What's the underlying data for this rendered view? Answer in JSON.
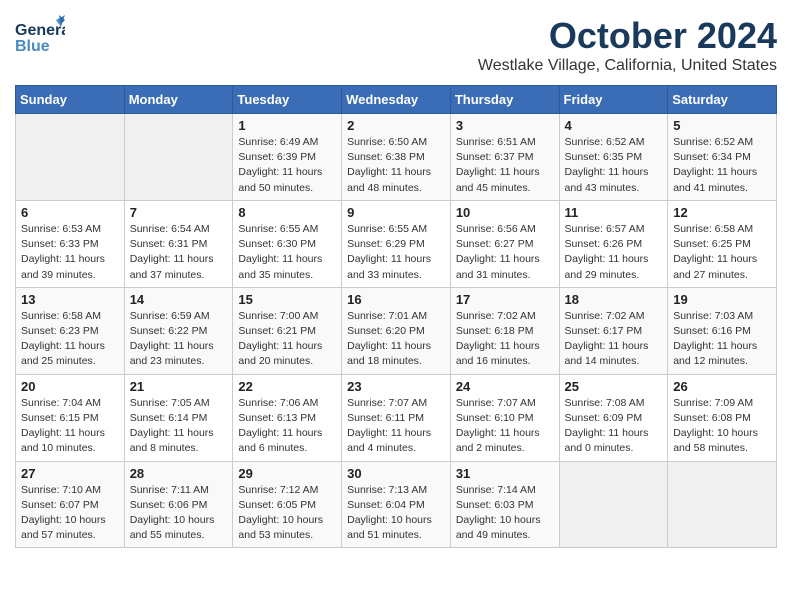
{
  "header": {
    "logo_general": "General",
    "logo_blue": "Blue",
    "title": "October 2024",
    "subtitle": "Westlake Village, California, United States"
  },
  "weekdays": [
    "Sunday",
    "Monday",
    "Tuesday",
    "Wednesday",
    "Thursday",
    "Friday",
    "Saturday"
  ],
  "weeks": [
    [
      {
        "day": "",
        "info": ""
      },
      {
        "day": "",
        "info": ""
      },
      {
        "day": "1",
        "info": "Sunrise: 6:49 AM\nSunset: 6:39 PM\nDaylight: 11 hours and 50 minutes."
      },
      {
        "day": "2",
        "info": "Sunrise: 6:50 AM\nSunset: 6:38 PM\nDaylight: 11 hours and 48 minutes."
      },
      {
        "day": "3",
        "info": "Sunrise: 6:51 AM\nSunset: 6:37 PM\nDaylight: 11 hours and 45 minutes."
      },
      {
        "day": "4",
        "info": "Sunrise: 6:52 AM\nSunset: 6:35 PM\nDaylight: 11 hours and 43 minutes."
      },
      {
        "day": "5",
        "info": "Sunrise: 6:52 AM\nSunset: 6:34 PM\nDaylight: 11 hours and 41 minutes."
      }
    ],
    [
      {
        "day": "6",
        "info": "Sunrise: 6:53 AM\nSunset: 6:33 PM\nDaylight: 11 hours and 39 minutes."
      },
      {
        "day": "7",
        "info": "Sunrise: 6:54 AM\nSunset: 6:31 PM\nDaylight: 11 hours and 37 minutes."
      },
      {
        "day": "8",
        "info": "Sunrise: 6:55 AM\nSunset: 6:30 PM\nDaylight: 11 hours and 35 minutes."
      },
      {
        "day": "9",
        "info": "Sunrise: 6:55 AM\nSunset: 6:29 PM\nDaylight: 11 hours and 33 minutes."
      },
      {
        "day": "10",
        "info": "Sunrise: 6:56 AM\nSunset: 6:27 PM\nDaylight: 11 hours and 31 minutes."
      },
      {
        "day": "11",
        "info": "Sunrise: 6:57 AM\nSunset: 6:26 PM\nDaylight: 11 hours and 29 minutes."
      },
      {
        "day": "12",
        "info": "Sunrise: 6:58 AM\nSunset: 6:25 PM\nDaylight: 11 hours and 27 minutes."
      }
    ],
    [
      {
        "day": "13",
        "info": "Sunrise: 6:58 AM\nSunset: 6:23 PM\nDaylight: 11 hours and 25 minutes."
      },
      {
        "day": "14",
        "info": "Sunrise: 6:59 AM\nSunset: 6:22 PM\nDaylight: 11 hours and 23 minutes."
      },
      {
        "day": "15",
        "info": "Sunrise: 7:00 AM\nSunset: 6:21 PM\nDaylight: 11 hours and 20 minutes."
      },
      {
        "day": "16",
        "info": "Sunrise: 7:01 AM\nSunset: 6:20 PM\nDaylight: 11 hours and 18 minutes."
      },
      {
        "day": "17",
        "info": "Sunrise: 7:02 AM\nSunset: 6:18 PM\nDaylight: 11 hours and 16 minutes."
      },
      {
        "day": "18",
        "info": "Sunrise: 7:02 AM\nSunset: 6:17 PM\nDaylight: 11 hours and 14 minutes."
      },
      {
        "day": "19",
        "info": "Sunrise: 7:03 AM\nSunset: 6:16 PM\nDaylight: 11 hours and 12 minutes."
      }
    ],
    [
      {
        "day": "20",
        "info": "Sunrise: 7:04 AM\nSunset: 6:15 PM\nDaylight: 11 hours and 10 minutes."
      },
      {
        "day": "21",
        "info": "Sunrise: 7:05 AM\nSunset: 6:14 PM\nDaylight: 11 hours and 8 minutes."
      },
      {
        "day": "22",
        "info": "Sunrise: 7:06 AM\nSunset: 6:13 PM\nDaylight: 11 hours and 6 minutes."
      },
      {
        "day": "23",
        "info": "Sunrise: 7:07 AM\nSunset: 6:11 PM\nDaylight: 11 hours and 4 minutes."
      },
      {
        "day": "24",
        "info": "Sunrise: 7:07 AM\nSunset: 6:10 PM\nDaylight: 11 hours and 2 minutes."
      },
      {
        "day": "25",
        "info": "Sunrise: 7:08 AM\nSunset: 6:09 PM\nDaylight: 11 hours and 0 minutes."
      },
      {
        "day": "26",
        "info": "Sunrise: 7:09 AM\nSunset: 6:08 PM\nDaylight: 10 hours and 58 minutes."
      }
    ],
    [
      {
        "day": "27",
        "info": "Sunrise: 7:10 AM\nSunset: 6:07 PM\nDaylight: 10 hours and 57 minutes."
      },
      {
        "day": "28",
        "info": "Sunrise: 7:11 AM\nSunset: 6:06 PM\nDaylight: 10 hours and 55 minutes."
      },
      {
        "day": "29",
        "info": "Sunrise: 7:12 AM\nSunset: 6:05 PM\nDaylight: 10 hours and 53 minutes."
      },
      {
        "day": "30",
        "info": "Sunrise: 7:13 AM\nSunset: 6:04 PM\nDaylight: 10 hours and 51 minutes."
      },
      {
        "day": "31",
        "info": "Sunrise: 7:14 AM\nSunset: 6:03 PM\nDaylight: 10 hours and 49 minutes."
      },
      {
        "day": "",
        "info": ""
      },
      {
        "day": "",
        "info": ""
      }
    ]
  ]
}
